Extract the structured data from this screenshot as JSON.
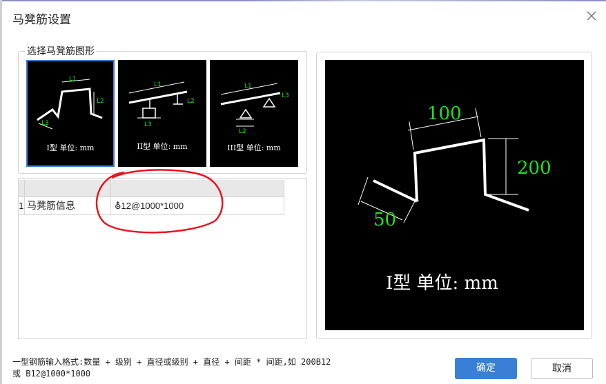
{
  "dialog": {
    "title": "马凳筋设置",
    "group_label": "选择马凳筋图形",
    "thumbnails": [
      {
        "label": "I型 单位: mm",
        "selected": true,
        "dims": [
          "L1",
          "L2",
          "L3"
        ]
      },
      {
        "label": "II型 单位: mm",
        "selected": false,
        "dims": [
          "L1",
          "L2",
          "L3"
        ]
      },
      {
        "label": "III型 单位: mm",
        "selected": false,
        "dims": [
          "L1",
          "L3",
          "L2"
        ]
      }
    ],
    "table": {
      "row_number": "1",
      "name": "马凳筋信息",
      "value": "⛢12@1000*1000"
    },
    "preview": {
      "dim_top": "100",
      "dim_right": "200",
      "dim_left": "50",
      "caption": "I型 单位: mm"
    },
    "hint_line1": "一型钢筋输入格式:数量 + 级别 + 直径或级别 + 直径 + 间距 * 间距,如 200B12",
    "hint_line2": "或 B12@1000*1000",
    "buttons": {
      "ok": "确定",
      "cancel": "取消"
    },
    "colors": {
      "accent": "#3a7fd6",
      "dimension_green": "#19e619",
      "annotation_red": "#e8141e"
    }
  }
}
